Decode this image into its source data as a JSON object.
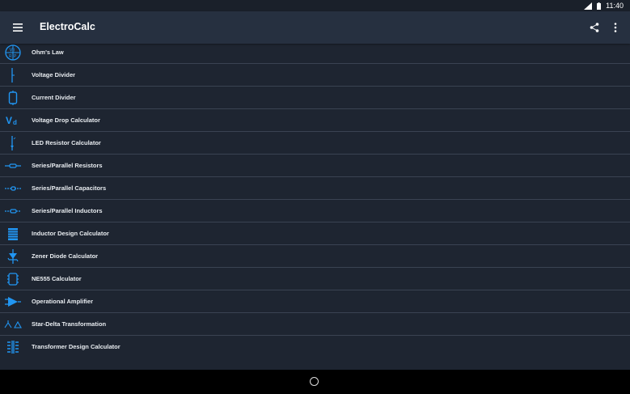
{
  "status_bar": {
    "time": "11:40"
  },
  "app_bar": {
    "title": "ElectroCalc"
  },
  "menu_items": [
    {
      "label": "Ohm's Law",
      "icon": "ohms-law-icon"
    },
    {
      "label": "Voltage Divider",
      "icon": "voltage-divider-icon"
    },
    {
      "label": "Current Divider",
      "icon": "current-divider-icon"
    },
    {
      "label": "Voltage Drop Calculator",
      "icon": "voltage-drop-icon"
    },
    {
      "label": "LED Resistor Calculator",
      "icon": "led-resistor-icon"
    },
    {
      "label": "Series/Parallel Resistors",
      "icon": "resistor-icon"
    },
    {
      "label": "Series/Parallel Capacitors",
      "icon": "capacitor-icon"
    },
    {
      "label": "Series/Parallel Inductors",
      "icon": "inductor-icon"
    },
    {
      "label": "Inductor Design Calculator",
      "icon": "inductor-design-icon"
    },
    {
      "label": "Zener Diode Calculator",
      "icon": "zener-diode-icon"
    },
    {
      "label": "NE555 Calculator",
      "icon": "ne555-icon"
    },
    {
      "label": "Operational Amplifier",
      "icon": "op-amp-icon"
    },
    {
      "label": "Star-Delta Transformation",
      "icon": "star-delta-icon"
    },
    {
      "label": "Transformer Design Calculator",
      "icon": "transformer-icon"
    }
  ],
  "colors": {
    "background": "#1e2531",
    "app_bar": "#263040",
    "accent_icon": "#2196f3",
    "divider": "#3a4352"
  }
}
